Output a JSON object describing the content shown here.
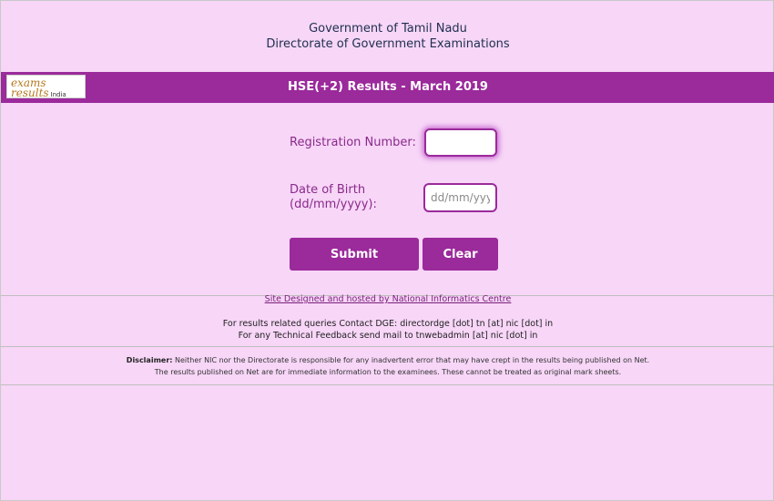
{
  "header": {
    "line1": "Government of Tamil Nadu",
    "line2": "Directorate of Government Examinations"
  },
  "banner": {
    "title": "HSE(+2) Results  - March 2019",
    "logo": {
      "l1": "exams",
      "l2": "results",
      "l3": "India"
    }
  },
  "form": {
    "registration_label": "Registration Number:",
    "registration_value": "",
    "dob_label_line1": "Date of Birth",
    "dob_label_line2": "(dd/mm/yyyy):",
    "dob_placeholder": "dd/mm/yyyy",
    "submit_label": "Submit",
    "clear_label": "Clear"
  },
  "footer": {
    "nic_link": "Site Designed and hosted by National Informatics Centre",
    "contact_line1": "For results related queries Contact DGE:  directordge [dot] tn [at] nic [dot] in",
    "contact_line2": "For any Technical Feedback send mail to tnwebadmin [at] nic [dot] in",
    "disclaimer_label": "Disclaimer:",
    "disclaimer_line1": " Neither NIC nor the Directorate is responsible for any inadvertent error that may have crept in the results being published on Net.",
    "disclaimer_line2": "The results published on Net are for immediate information to the examinees. These cannot be treated as original mark sheets."
  },
  "colors": {
    "background": "#f7d6f7",
    "accent": "#9b2a9b"
  }
}
